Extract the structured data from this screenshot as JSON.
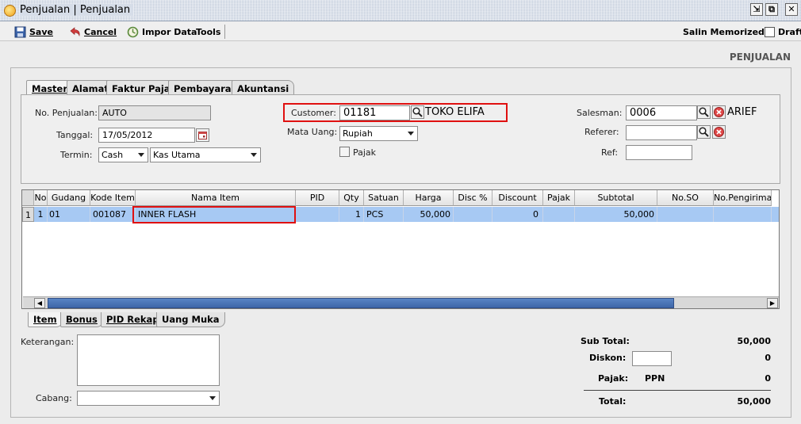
{
  "window": {
    "title": "Penjualan | Penjualan",
    "btn_restore": "⇲",
    "btn_popout": "⧉",
    "btn_close": "✕"
  },
  "toolbar": {
    "save": "Save",
    "cancel": "Cancel",
    "import": "Impor Data",
    "tools": "Tools",
    "salin": "Salin Memorized",
    "draft": "Draft"
  },
  "panel_title": "PENJUALAN",
  "tabs": [
    "Master",
    "Alamat",
    "Faktur Pajak",
    "Pembayaran",
    "Akuntansi"
  ],
  "master": {
    "no_penjualan_label": "No. Penjualan:",
    "no_penjualan": "AUTO",
    "tanggal_label": "Tanggal:",
    "tanggal": "17/05/2012",
    "termin_label": "Termin:",
    "termin": "Cash",
    "kas": "Kas Utama",
    "customer_label": "Customer:",
    "customer_code": "01181",
    "customer_name": "TOKO ELIFA",
    "mata_uang_label": "Mata Uang:",
    "mata_uang": "Rupiah",
    "pajak_label": "Pajak",
    "salesman_label": "Salesman:",
    "salesman_code": "0006",
    "salesman_name": "ARIEF",
    "referer_label": "Referer:",
    "ref_label": "Ref:"
  },
  "grid": {
    "columns": [
      "No",
      "Gudang",
      "Kode Item",
      "Nama Item",
      "PID",
      "Qty",
      "Satuan",
      "Harga",
      "Disc %",
      "Discount",
      "Pajak",
      "Subtotal",
      "No.SO",
      "No.Pengiriman"
    ],
    "rows": [
      {
        "rownum": "1",
        "no": "1",
        "gudang": "01",
        "kode": "001087",
        "nama": "INNER FLASH",
        "pid": "",
        "qty": "1",
        "satuan": "PCS",
        "harga": "50,000",
        "disc": "",
        "discount": "0",
        "pajak": "",
        "subtotal": "50,000",
        "so": "",
        "pengiriman": ""
      }
    ]
  },
  "bottom_tabs": [
    "Item",
    "Bonus",
    "PID Rekap",
    "Uang Muka"
  ],
  "footer": {
    "keterangan_label": "Keterangan:",
    "cabang_label": "Cabang:",
    "subtotal_label": "Sub Total:",
    "subtotal": "50,000",
    "diskon_label": "Diskon:",
    "diskon": "0",
    "pajak_label": "Pajak:",
    "pajak_type": "PPN",
    "pajak": "0",
    "total_label": "Total:",
    "total": "50,000"
  },
  "colors": {
    "highlight": "#e01010",
    "selected_row": "#a7c9f3",
    "scroll_thumb": "#4a74b8"
  }
}
